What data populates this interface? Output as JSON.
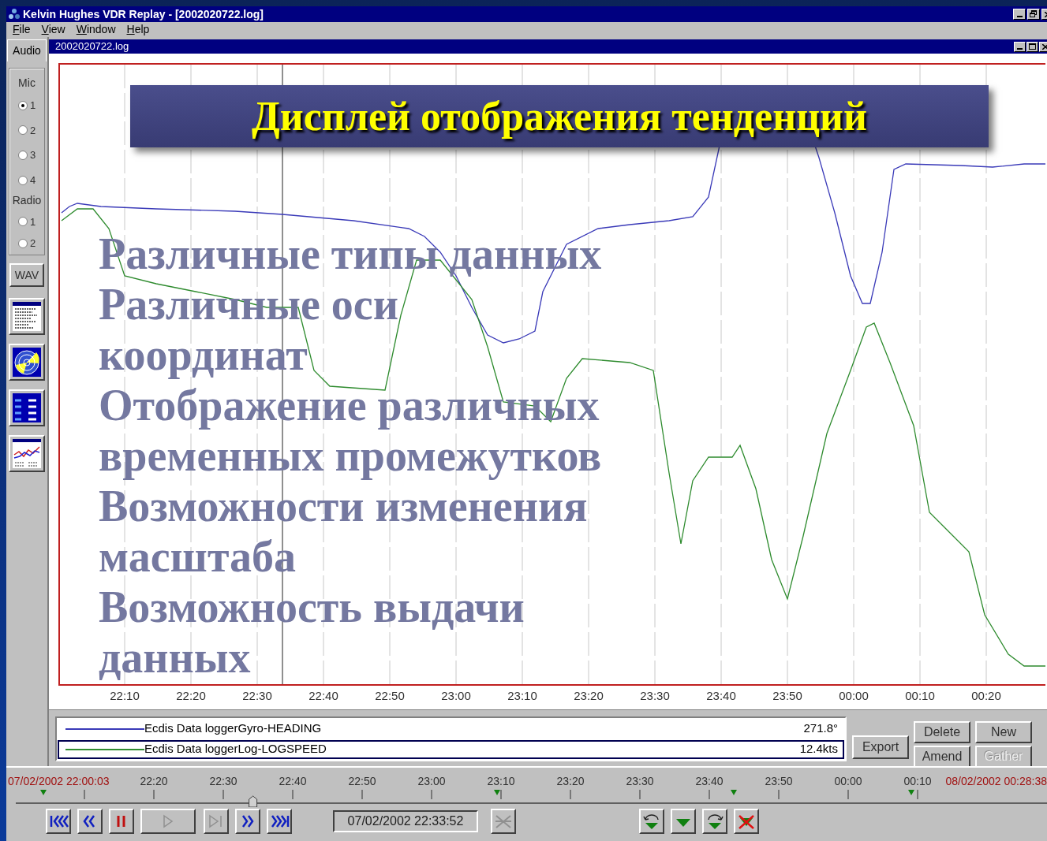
{
  "window": {
    "title": "Kelvin Hughes VDR Replay - [2002020722.log]"
  },
  "menu": [
    {
      "label": "File"
    },
    {
      "label": "View"
    },
    {
      "label": "Window"
    },
    {
      "label": "Help"
    }
  ],
  "sidebar": {
    "tab": "Audio",
    "groups": [
      {
        "label": "Mic",
        "options": [
          {
            "label": "1",
            "selected": true
          },
          {
            "label": "2",
            "selected": false
          },
          {
            "label": "3",
            "selected": false
          },
          {
            "label": "4",
            "selected": false
          }
        ]
      },
      {
        "label": "Radio",
        "options": [
          {
            "label": "1",
            "selected": false
          },
          {
            "label": "2",
            "selected": false
          }
        ]
      }
    ],
    "wav_button": "WAV"
  },
  "document": {
    "title": "2002020722.log",
    "axis_labels": [
      "22:10",
      "22:20",
      "22:30",
      "22:40",
      "22:50",
      "23:00",
      "23:10",
      "23:20",
      "23:30",
      "23:40",
      "23:50",
      "00:00",
      "00:10",
      "00:20"
    ],
    "legend": [
      {
        "name": "Ecdis Data loggerGyro-HEADING",
        "value": "271.8°",
        "color": "#3a3ab8",
        "selected": false
      },
      {
        "name": "Ecdis Data loggerLog-LOGSPEED",
        "value": "12.4kts",
        "color": "#2e8b2e",
        "selected": true
      }
    ],
    "buttons": [
      {
        "label": "Export",
        "disabled": false
      },
      {
        "label": "Delete",
        "disabled": false
      },
      {
        "label": "New",
        "disabled": false
      },
      {
        "label": "Amend",
        "disabled": false
      },
      {
        "label": "Gather",
        "disabled": true
      }
    ]
  },
  "timeline": {
    "start": "07/02/2002 22:00:03",
    "end": "08/02/2002 00:28:38",
    "labels": [
      "22:20",
      "22:30",
      "22:40",
      "22:50",
      "23:00",
      "23:10",
      "23:20",
      "23:30",
      "23:40",
      "23:50",
      "00:00",
      "00:10"
    ],
    "level": 0.23,
    "current_time": "07/02/2002 22:33:52",
    "controls": [
      {
        "kind": "first",
        "disabled": false
      },
      {
        "kind": "rewind",
        "disabled": false
      },
      {
        "kind": "pause",
        "disabled": false
      },
      {
        "kind": "play",
        "disabled": true
      },
      {
        "kind": "step",
        "disabled": true
      },
      {
        "kind": "forward",
        "disabled": false
      },
      {
        "kind": "last",
        "disabled": false
      }
    ],
    "marker_controls": [
      {
        "kind": "clear",
        "disabled": true
      },
      {
        "kind": "previous",
        "disabled": false
      },
      {
        "kind": "add",
        "disabled": false
      },
      {
        "kind": "next",
        "disabled": false
      },
      {
        "kind": "delete",
        "disabled": false
      }
    ]
  },
  "overlay": {
    "title": "Дисплей отображения тенденций",
    "bullets": [
      "Различные типы данных",
      "Различные оси координат",
      "Отображение различных временных промежутков",
      "Возможности изменения масштаба",
      "Возможность выдачи данных"
    ]
  }
}
